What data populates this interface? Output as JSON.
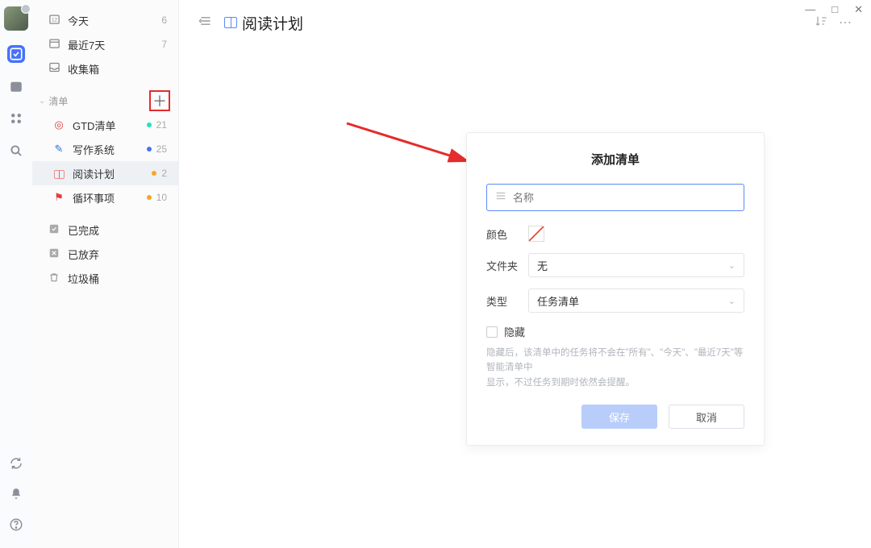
{
  "window_controls": {
    "min": "—",
    "max": "□",
    "close": "✕"
  },
  "rail_icons": [
    "check",
    "calendar",
    "grid",
    "search"
  ],
  "rail_bottom_icons": [
    "sync",
    "bell",
    "help"
  ],
  "sidebar": {
    "smart": [
      {
        "icon": "📅",
        "label": "今天",
        "count": "6"
      },
      {
        "icon": "🗓",
        "label": "最近7天",
        "count": "7"
      },
      {
        "icon": "📥",
        "label": "收集箱",
        "count": ""
      }
    ],
    "section_label": "清单",
    "add_btn": "＋",
    "lists": [
      {
        "icon": "🎯",
        "label": "GTD清单",
        "dot": "#26e0b8",
        "count": "21"
      },
      {
        "icon": "✏️",
        "label": "写作系统",
        "dot": "#4772fa",
        "count": "25"
      },
      {
        "icon": "📖",
        "label": "阅读计划",
        "dot": "#f6a623",
        "count": "2",
        "selected": true
      },
      {
        "icon": "🚩",
        "label": "循环事项",
        "dot": "#f6a623",
        "count": "10"
      }
    ],
    "footer": [
      {
        "icon": "✔",
        "label": "已完成"
      },
      {
        "icon": "✖",
        "label": "已放弃"
      },
      {
        "icon": "🗑",
        "label": "垃圾桶"
      }
    ]
  },
  "header": {
    "title": "阅读计划"
  },
  "dialog": {
    "title": "添加清单",
    "name_placeholder": "名称",
    "color_label": "颜色",
    "folder_label": "文件夹",
    "folder_value": "无",
    "type_label": "类型",
    "type_value": "任务清单",
    "hide_label": "隐藏",
    "hide_hint_1": "隐藏后，该清单中的任务将不会在\"所有\"、\"今天\"、\"最近7天\"等智能清单中",
    "hide_hint_2": "显示，不过任务到期时依然会提醒。",
    "save": "保存",
    "cancel": "取消"
  }
}
